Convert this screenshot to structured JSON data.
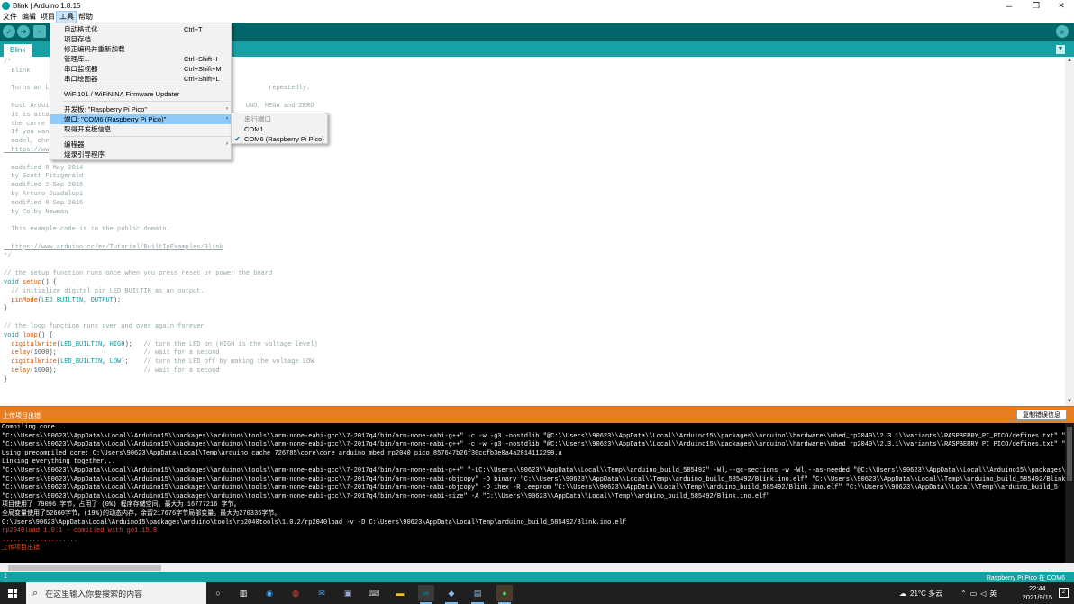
{
  "window": {
    "title": "Blink | Arduino 1.8.15",
    "controls": [
      "─",
      "❐",
      "✕"
    ]
  },
  "menubar": [
    "文件",
    "编辑",
    "项目",
    "工具",
    "帮助"
  ],
  "toolbar": {
    "buttons": [
      "verify-icon",
      "upload-icon",
      "new-icon",
      "open-icon",
      "save-icon"
    ],
    "serial_monitor_icon": "search-icon"
  },
  "tabs": {
    "active": "Blink",
    "menu_glyph": "▼"
  },
  "editor": {
    "lines": [
      [
        [
          "c",
          "/*"
        ]
      ],
      [
        [
          "c",
          "  Blink"
        ]
      ],
      [
        [
          "c",
          ""
        ]
      ],
      [
        [
          "c",
          "  Turns an L                                                          repeatedly."
        ]
      ],
      [
        [
          "c",
          ""
        ]
      ],
      [
        [
          "c",
          "  Most Ardui                                                    UNO, MEGA and ZERO"
        ]
      ],
      [
        [
          "c",
          "  it is atta"
        ]
      ],
      [
        [
          "c",
          "  the corre"
        ]
      ],
      [
        [
          "c",
          "  If you wan"
        ]
      ],
      [
        [
          "c",
          "  model, che"
        ]
      ],
      [
        [
          "u",
          "  https://ww"
        ]
      ],
      [
        [
          "c",
          ""
        ]
      ],
      [
        [
          "c",
          "  modified 8 May 2014"
        ]
      ],
      [
        [
          "c",
          "  by Scott Fitzgerald"
        ]
      ],
      [
        [
          "c",
          "  modified 2 Sep 2016"
        ]
      ],
      [
        [
          "c",
          "  by Arturo Guadalupi"
        ]
      ],
      [
        [
          "c",
          "  modified 8 Sep 2016"
        ]
      ],
      [
        [
          "c",
          "  by Colby Newman"
        ]
      ],
      [
        [
          "c",
          ""
        ]
      ],
      [
        [
          "c",
          "  This example code is in the public domain."
        ]
      ],
      [
        [
          "c",
          ""
        ]
      ],
      [
        [
          "u",
          "  https://www.arduino.cc/en/Tutorial/BuiltInExamples/Blink"
        ]
      ],
      [
        [
          "c",
          "*/"
        ]
      ],
      [
        [
          "n",
          ""
        ]
      ],
      [
        [
          "c",
          "// the setup function runs once when you press reset or power the board"
        ]
      ],
      [
        [
          "k",
          "void"
        ],
        [
          "n",
          " "
        ],
        [
          "f",
          "setup"
        ],
        [
          "n",
          "() {"
        ]
      ],
      [
        [
          "c",
          "  // initialize digital pin LED_BUILTIN as an output."
        ]
      ],
      [
        [
          "n",
          "  "
        ],
        [
          "f",
          "pinMode"
        ],
        [
          "n",
          "("
        ],
        [
          "k",
          "LED_BUILTIN"
        ],
        [
          "n",
          ", "
        ],
        [
          "k",
          "OUTPUT"
        ],
        [
          "n",
          ");"
        ]
      ],
      [
        [
          "n",
          "}"
        ]
      ],
      [
        [
          "n",
          ""
        ]
      ],
      [
        [
          "c",
          "// the loop function runs over and over again forever"
        ]
      ],
      [
        [
          "k",
          "void"
        ],
        [
          "n",
          " "
        ],
        [
          "f",
          "loop"
        ],
        [
          "n",
          "() {"
        ]
      ],
      [
        [
          "n",
          "  "
        ],
        [
          "f",
          "digitalWrite"
        ],
        [
          "n",
          "("
        ],
        [
          "k",
          "LED_BUILTIN"
        ],
        [
          "n",
          ", "
        ],
        [
          "k",
          "HIGH"
        ],
        [
          "n",
          ");   "
        ],
        [
          "c",
          "// turn the LED on (HIGH is the voltage level)"
        ]
      ],
      [
        [
          "n",
          "  "
        ],
        [
          "f",
          "delay"
        ],
        [
          "n",
          "(1000);                       "
        ],
        [
          "c",
          "// wait for a second"
        ]
      ],
      [
        [
          "n",
          "  "
        ],
        [
          "f",
          "digitalWrite"
        ],
        [
          "n",
          "("
        ],
        [
          "k",
          "LED_BUILTIN"
        ],
        [
          "n",
          ", "
        ],
        [
          "k",
          "LOW"
        ],
        [
          "n",
          ");    "
        ],
        [
          "c",
          "// turn the LED off by making the voltage LOW"
        ]
      ],
      [
        [
          "n",
          "  "
        ],
        [
          "f",
          "delay"
        ],
        [
          "n",
          "(1000);                       "
        ],
        [
          "c",
          "// wait for a second"
        ]
      ],
      [
        [
          "n",
          "}"
        ]
      ]
    ]
  },
  "tools_menu": {
    "items": [
      {
        "label": "自动格式化",
        "shortcut": "Ctrl+T"
      },
      {
        "label": "项目存档",
        "shortcut": ""
      },
      {
        "label": "修正编码并重新加载",
        "shortcut": ""
      },
      {
        "label": "管理库...",
        "shortcut": "Ctrl+Shift+I"
      },
      {
        "label": "串口监视器",
        "shortcut": "Ctrl+Shift+M"
      },
      {
        "label": "串口绘图器",
        "shortcut": "Ctrl+Shift+L"
      },
      {
        "label": "WiFi101 / WiFiNINA Firmware Updater",
        "shortcut": ""
      },
      {
        "label": "开发板: \"Raspberry Pi Pico\"",
        "shortcut": ""
      },
      {
        "label": "端口: \"COM6 (Raspberry Pi Pico)\"",
        "shortcut": ""
      },
      {
        "label": "取得开发板信息",
        "shortcut": ""
      },
      {
        "label": "编程器",
        "shortcut": ""
      },
      {
        "label": "烧录引导程序",
        "shortcut": ""
      }
    ],
    "submenu_arrow": "›"
  },
  "port_submenu": {
    "header": "串行端口",
    "items": [
      "COM1",
      "COM6 (Raspberry Pi Pico)"
    ],
    "selected": "COM6 (Raspberry Pi Pico)",
    "check": "✔"
  },
  "console": {
    "status": "上传项目出错",
    "copy_button": "复制错误信息",
    "lines": [
      {
        "text": "Compiling core...",
        "err": false
      },
      {
        "text": "\"C:\\\\Users\\\\90623\\\\AppData\\\\Local\\\\Arduino15\\\\packages\\\\arduino\\\\tools\\\\arm-none-eabi-gcc\\\\7-2017q4/bin/arm-none-eabi-g++\" -c -w -g3 -nostdlib \"@C:\\\\Users\\\\90623\\\\AppData\\\\Local\\\\Arduino15\\\\packages\\\\arduino\\\\hardware\\\\mbed_rp2040\\\\2.3.1\\\\variants\\\\RASPBERRY_PI_PICO/defines.txt\" \"@",
        "err": false
      },
      {
        "text": "\"C:\\\\Users\\\\90623\\\\AppData\\\\Local\\\\Arduino15\\\\packages\\\\arduino\\\\tools\\\\arm-none-eabi-gcc\\\\7-2017q4/bin/arm-none-eabi-g++\" -c -w -g3 -nostdlib \"@C:\\\\Users\\\\90623\\\\AppData\\\\Local\\\\Arduino15\\\\packages\\\\arduino\\\\hardware\\\\mbed_rp2040\\\\2.3.1\\\\variants\\\\RASPBERRY_PI_PICO/defines.txt\" \"@",
        "err": false
      },
      {
        "text": "Using precompiled core: C:\\Users\\90623\\AppData\\Local\\Temp\\arduino_cache_726785\\core\\core_arduino_mbed_rp2040_pico_857647b26f30ccfb3e0a4a2814112299.a",
        "err": false
      },
      {
        "text": "Linking everything together...",
        "err": false
      },
      {
        "text": "\"C:\\\\Users\\\\90623\\\\AppData\\\\Local\\\\Arduino15\\\\packages\\\\arduino\\\\tools\\\\arm-none-eabi-gcc\\\\7-2017q4/bin/arm-none-eabi-g++\" \"-LC:\\\\Users\\\\90623\\\\AppData\\\\Local\\\\Temp\\\\arduino_build_585492\" -Wl,--gc-sections -w -Wl,--as-needed \"@C:\\\\Users\\\\90623\\\\AppData\\\\Local\\\\Arduino15\\\\packages\\\\",
        "err": false
      },
      {
        "text": "\"C:\\\\Users\\\\90623\\\\AppData\\\\Local\\\\Arduino15\\\\packages\\\\arduino\\\\tools\\\\arm-none-eabi-gcc\\\\7-2017q4/bin/arm-none-eabi-objcopy\" -O binary \"C:\\\\Users\\\\90623\\\\AppData\\\\Local\\\\Temp\\\\arduino_build_585492/Blink.ino.elf\" \"C:\\\\Users\\\\90623\\\\AppData\\\\Local\\\\Temp\\\\arduino_build_585492/Blink.",
        "err": false
      },
      {
        "text": "\"C:\\\\Users\\\\90623\\\\AppData\\\\Local\\\\Arduino15\\\\packages\\\\arduino\\\\tools\\\\arm-none-eabi-gcc\\\\7-2017q4/bin/arm-none-eabi-objcopy\" -O ihex -R .eeprom \"C:\\\\Users\\\\90623\\\\AppData\\\\Local\\\\Temp\\\\arduino_build_585492/Blink.ino.elf\" \"C:\\\\Users\\\\90623\\\\AppData\\\\Local\\\\Temp\\\\arduino_build_5",
        "err": false
      },
      {
        "text": "\"C:\\\\Users\\\\90623\\\\AppData\\\\Local\\\\Arduino15\\\\packages\\\\arduino\\\\tools\\\\arm-none-eabi-gcc\\\\7-2017q4/bin/arm-none-eabi-size\" -A \"C:\\\\Users\\\\90623\\\\AppData\\\\Local\\\\Temp\\\\arduino_build_585492/Blink.ino.elf\"",
        "err": false
      },
      {
        "text": "项目使用了 79096 字节，占用了 (0%) 程序存储空间。最大为 16777216 字节。",
        "err": false
      },
      {
        "text": "全局变量使用了52660字节，(19%)的动态内存，余留217676字节局部变量。最大为270336字节。",
        "err": false
      },
      {
        "text": "C:\\Users\\90623\\AppData\\Local\\Arduino15\\packages\\arduino\\tools\\rp2040tools\\1.0.2/rp2040load -v -D C:\\Users\\90623\\AppData\\Local\\Temp\\arduino_build_585492/Blink.ino.elf",
        "err": false
      },
      {
        "text": "rp2040load 1.0.1 - compiled with go1.15.8",
        "err": true
      },
      {
        "text": "....................",
        "err": true
      },
      {
        "text": "上传项目出错",
        "err": true
      }
    ]
  },
  "statusline": {
    "line": "1",
    "board": "Raspberry Pi Pico 在 COM6"
  },
  "taskbar": {
    "search_placeholder": "在这里输入你要搜索的内容",
    "weather": "21°C 多云",
    "ime": "英",
    "time": "22:44",
    "date": "2021/9/15",
    "notifications": "2"
  }
}
